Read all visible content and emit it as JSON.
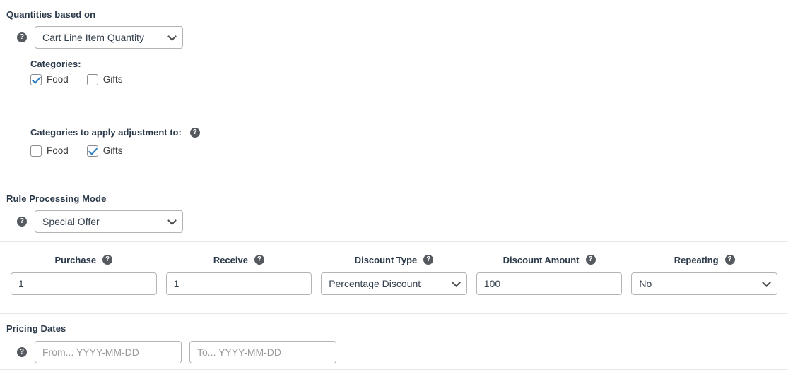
{
  "quantities_section": {
    "heading": "Quantities based on",
    "help_icon": "help-circle-icon",
    "select_value": "Cart Line Item Quantity",
    "select_options": [
      "Cart Line Item Quantity"
    ],
    "chevron_icon": "chevron-down-icon",
    "categories_label": "Categories:",
    "checkboxes": [
      {
        "label": "Food",
        "checked": true
      },
      {
        "label": "Gifts",
        "checked": false
      }
    ]
  },
  "apply_to_section": {
    "heading": "Categories to apply adjustment to:",
    "help_icon": "help-circle-icon",
    "checkboxes": [
      {
        "label": "Food",
        "checked": false
      },
      {
        "label": "Gifts",
        "checked": true
      }
    ]
  },
  "rule_mode_section": {
    "heading": "Rule Processing Mode",
    "help_icon": "help-circle-icon",
    "select_value": "Special Offer",
    "select_options": [
      "Special Offer"
    ],
    "chevron_icon": "chevron-down-icon"
  },
  "discount_table": {
    "columns": [
      {
        "header": "Purchase",
        "help_icon": "help-circle-icon",
        "type": "text",
        "value": "1"
      },
      {
        "header": "Receive",
        "help_icon": "help-circle-icon",
        "type": "text",
        "value": "1"
      },
      {
        "header": "Discount Type",
        "help_icon": "help-circle-icon",
        "type": "select",
        "value": "Percentage Discount"
      },
      {
        "header": "Discount Amount",
        "help_icon": "help-circle-icon",
        "type": "text",
        "value": "100"
      },
      {
        "header": "Repeating",
        "help_icon": "help-circle-icon",
        "type": "select",
        "value": "No"
      }
    ]
  },
  "pricing_dates_section": {
    "heading": "Pricing Dates",
    "help_icon": "help-circle-icon",
    "from_value": "",
    "from_placeholder": "From... YYYY-MM-DD",
    "to_value": "",
    "to_placeholder": "To... YYYY-MM-DD"
  },
  "colors": {
    "heading_text": "#2b3a4a",
    "body_text": "#3a3a3a",
    "input_text": "#34404d",
    "border": "#b4b4b8",
    "divider": "#e8e8ea",
    "checkbox_accent": "#2e7ec4",
    "help_icon_bg": "#555a60",
    "placeholder": "#9a9a9e"
  },
  "glyphs": {
    "help": "?"
  }
}
